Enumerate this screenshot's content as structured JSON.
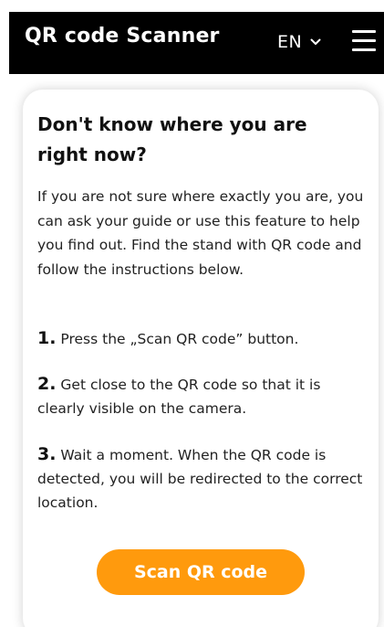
{
  "header": {
    "title": "QR code Scanner",
    "language": "EN",
    "language_icon": "chevron-down-icon",
    "menu_icon": "hamburger-menu-icon",
    "background_color": "#000000"
  },
  "card": {
    "title": "Don't know where you are right now?",
    "intro": "If you are not sure where exactly you are, you can ask your guide or use this feature to help you find out. Find the stand with QR code and follow the instructions below.",
    "steps": [
      {
        "number": "1.",
        "text": "Press the „Scan QR code” button."
      },
      {
        "number": "2.",
        "text": "Get close to the QR code so that it is clearly visible on the camera."
      },
      {
        "number": "3.",
        "text": "Wait a moment. When the QR code is detected, you will be redirected to the correct location."
      }
    ],
    "button_label": "Scan QR code",
    "button_color": "#ff9a0d"
  }
}
